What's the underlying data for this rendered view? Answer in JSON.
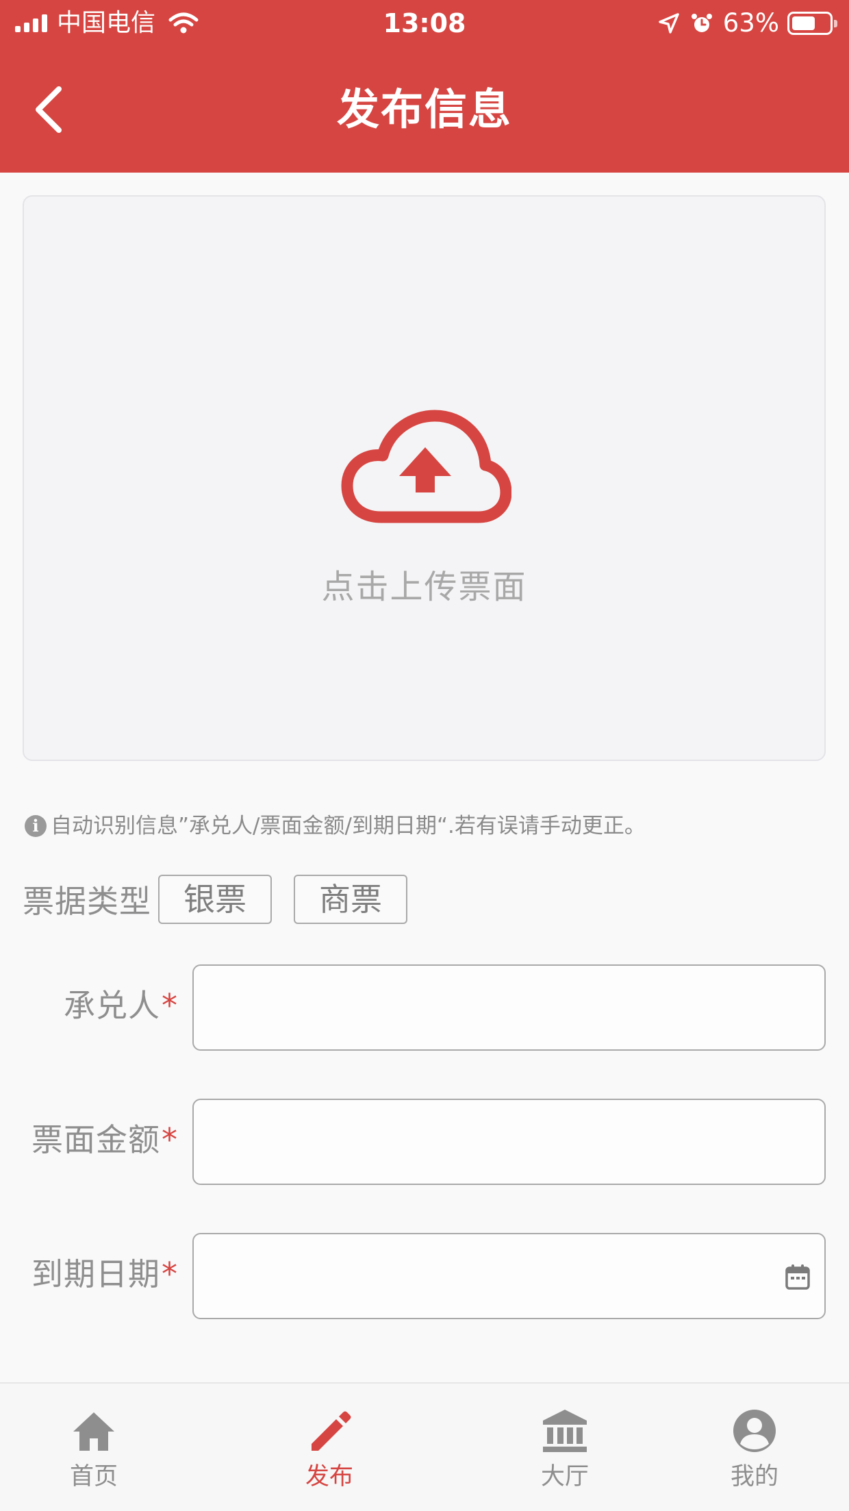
{
  "status_bar": {
    "carrier": "中国电信",
    "time": "13:08",
    "battery_percent": "63%",
    "battery_level": 0.63
  },
  "nav": {
    "title": "发布信息"
  },
  "upload": {
    "label": "点击上传票面"
  },
  "hint": {
    "text": "自动识别信息”承兑人/票面金额/到期日期“.若有误请手动更正。"
  },
  "bill_type": {
    "label": "票据类型",
    "options": [
      "银票",
      "商票"
    ]
  },
  "form": {
    "required_mark": "*",
    "acceptor": {
      "label": "承兑人",
      "value": ""
    },
    "face_amount": {
      "label": "票面金额",
      "value": ""
    },
    "due_date": {
      "label": "到期日期",
      "value": ""
    }
  },
  "tab_bar": {
    "items": [
      {
        "label": "首页",
        "icon": "home-icon",
        "active": false
      },
      {
        "label": "发布",
        "icon": "pencil-icon",
        "active": true
      },
      {
        "label": "大厅",
        "icon": "bank-icon",
        "active": false
      },
      {
        "label": "我的",
        "icon": "user-icon",
        "active": false
      }
    ]
  },
  "colors": {
    "primary": "#d64541",
    "text_gray": "#8e8e8e",
    "border_gray": "#a9a9a9",
    "upload_bg": "#f4f4f6"
  }
}
